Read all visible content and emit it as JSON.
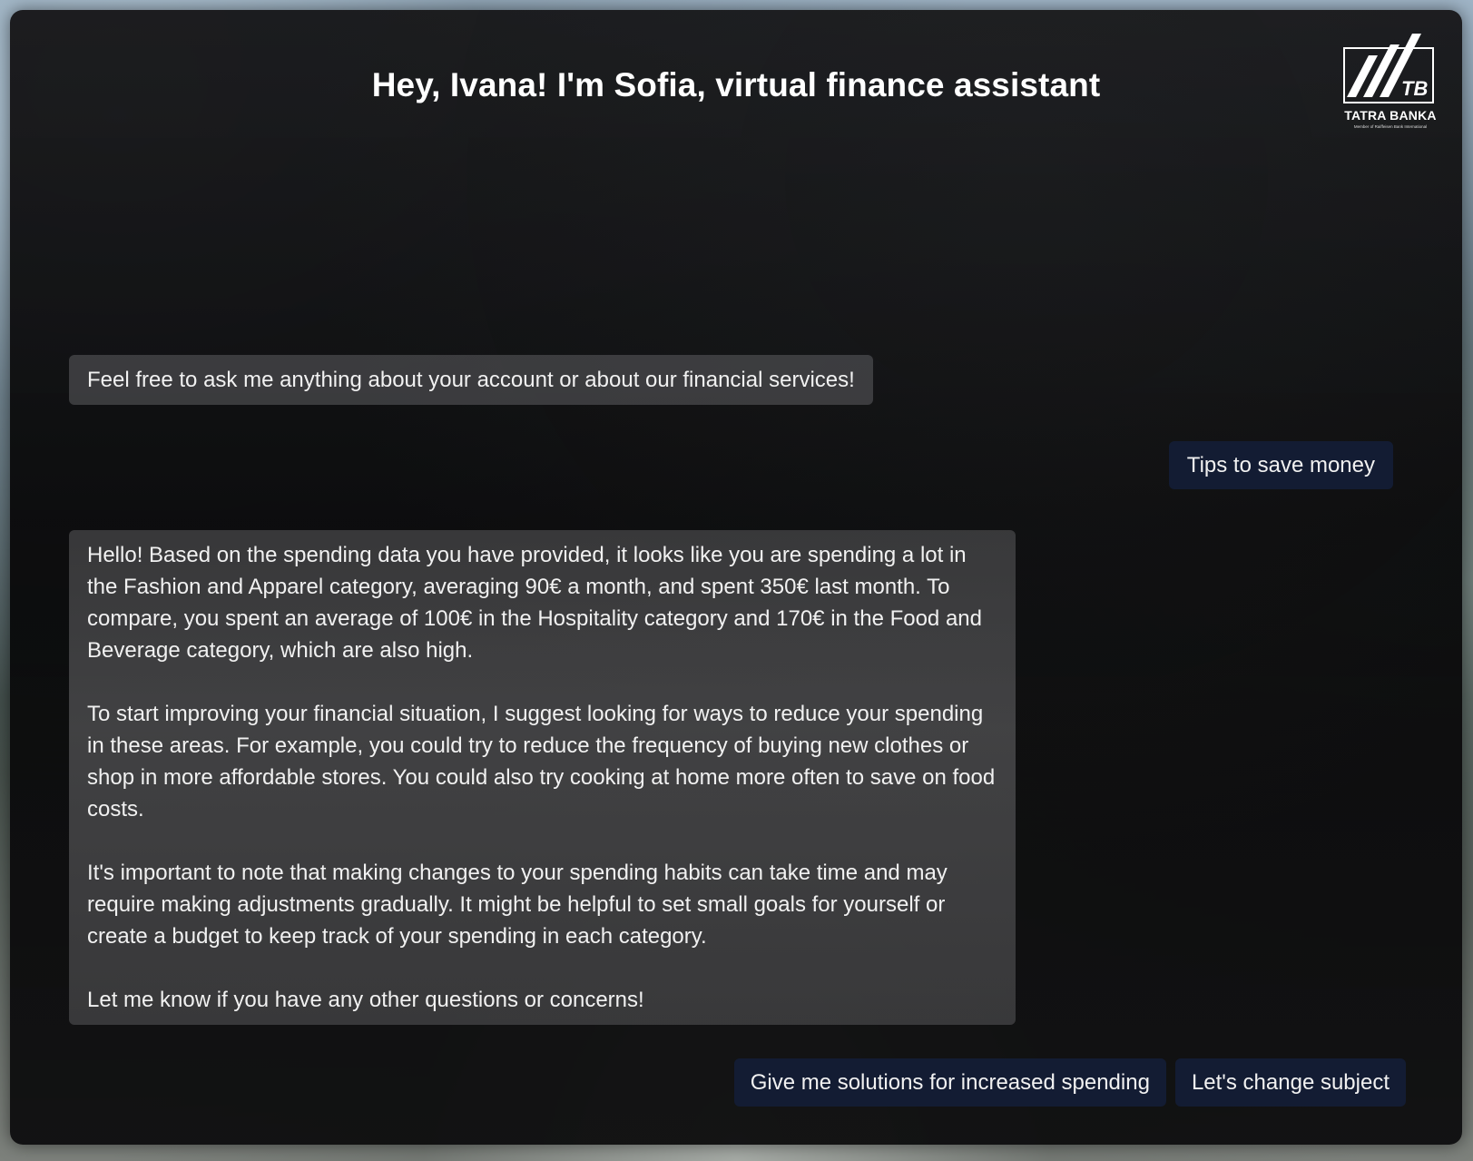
{
  "header": {
    "title": "Hey, Ivana! I'm Sofia, virtual finance assistant"
  },
  "logo": {
    "monogram": "TB",
    "name": "TATRA BANKA",
    "subtitle": "Member of Raiffeisen Bank International"
  },
  "messages": [
    {
      "role": "assistant",
      "paragraphs": [
        "Feel free to ask me anything about your account or about our financial services!"
      ]
    },
    {
      "role": "user",
      "paragraphs": [
        "Tips to save money"
      ]
    },
    {
      "role": "assistant",
      "paragraphs": [
        "Hello! Based on the spending data you have provided, it looks like you are spending a lot in the Fashion and Apparel category, averaging 90€ a month, and spent 350€ last month. To compare, you spent an average of 100€ in the Hospitality category and 170€ in the Food and Beverage category, which are also high.",
        "To start improving your financial situation, I suggest looking for ways to reduce your spending in these areas. For example, you could try to reduce the frequency of buying new clothes or shop in more affordable stores. You could also try cooking at home more often to save on food costs.",
        "It's important to note that making changes to your spending habits can take time and may require making adjustments gradually. It might be helpful to set small goals for yourself or create a budget to keep track of your spending in each category.",
        "Let me know if you have any other questions or concerns!"
      ]
    }
  ],
  "suggestions": [
    "Give me solutions for increased spending",
    "Let's change subject"
  ],
  "colors": {
    "user_bubble": "#131c33",
    "assistant_bubble": "#4a4a4c",
    "panel": "#111112",
    "text": "#f1f1f1"
  }
}
